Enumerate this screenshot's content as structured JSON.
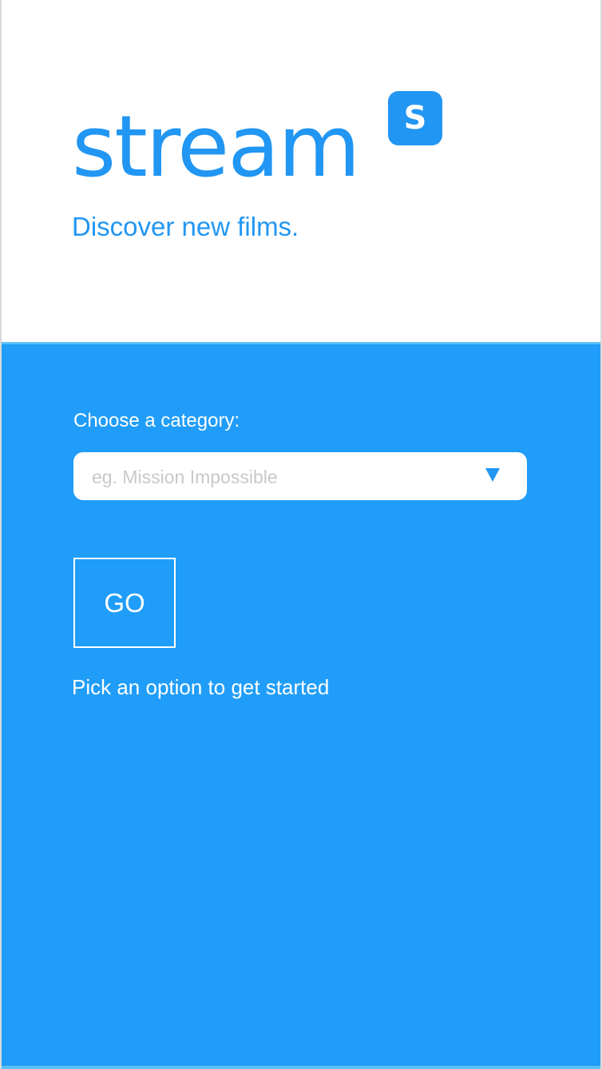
{
  "header": {
    "logo_text": "stream",
    "logo_badge": "S",
    "tagline": "Discover new films."
  },
  "form": {
    "category_label": "Choose a category:",
    "select_placeholder": "eg. Mission Impossible",
    "dropdown_icon": "triangle-down-icon",
    "go_label": "GO",
    "hint": "Pick an option to get started"
  },
  "colors": {
    "brand_blue": "#2196f3",
    "panel_blue": "#209df9",
    "panel_border": "#5cc0f7",
    "placeholder_gray": "#c8c8c8",
    "white": "#ffffff"
  }
}
